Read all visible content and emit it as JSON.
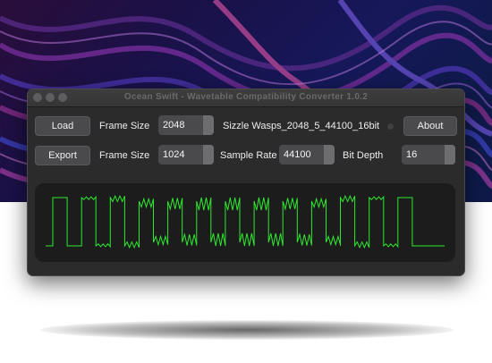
{
  "window": {
    "title": "Ocean Swift - Wavetable Compatibility Converter 1.0.2"
  },
  "row1": {
    "load_label": "Load",
    "frame_size_label": "Frame Size",
    "frame_size_value": "2048",
    "file_name": "Sizzle Wasps_2048_5_44100_16bit",
    "about_label": "About"
  },
  "row2": {
    "export_label": "Export",
    "frame_size_label": "Frame Size",
    "frame_size_value": "1024",
    "sample_rate_label": "Sample Rate",
    "sample_rate_value": "44100",
    "bit_depth_label": "Bit Depth",
    "bit_depth_value": "16"
  },
  "colors": {
    "waveform": "#2ee82e",
    "panel": "#2b2b2c",
    "scope_background": "#1c1c1d"
  }
}
